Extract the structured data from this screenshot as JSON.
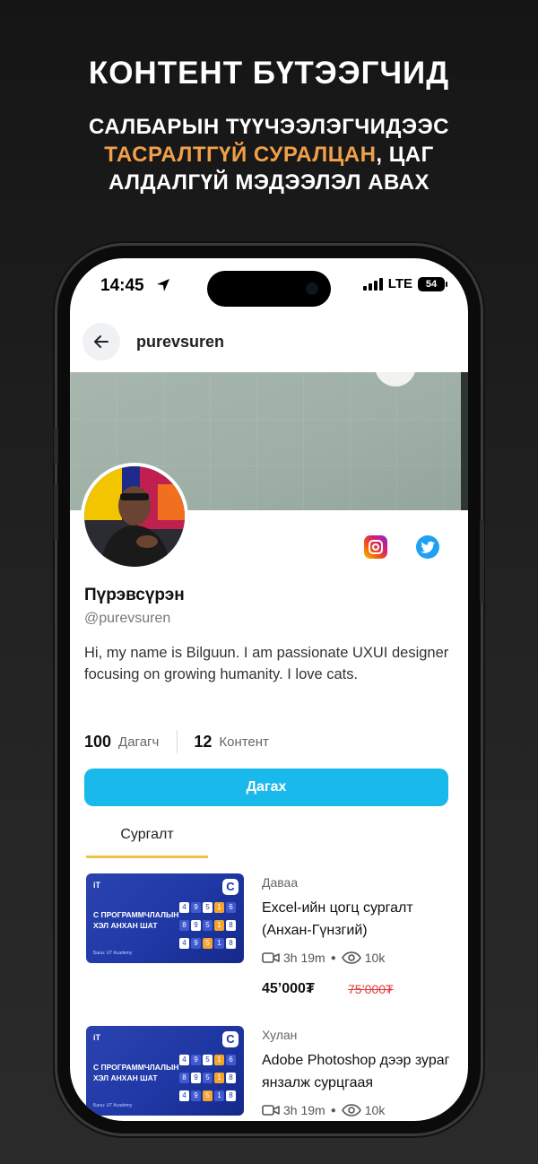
{
  "promo": {
    "title": "КОНТЕНТ БҮТЭЭГЧИД",
    "subtitle_line1": "САЛБАРЫН ТҮҮЧЭЭЛЭГЧИДЭЭС",
    "subtitle_accent": "ТАСРАЛТГҮЙ СУРАЛЦАН",
    "subtitle_after_accent": ", ЦАГ",
    "subtitle_line3": "АЛДАЛГҮЙ МЭДЭЭЛЭЛ АВАХ",
    "accent_color": "#f0a04a"
  },
  "status_bar": {
    "time": "14:45",
    "network": "LTE",
    "battery": "54"
  },
  "header": {
    "username": "purevsuren",
    "back_icon": "arrow-left-icon"
  },
  "profile": {
    "display_name": "Пүрэвсүрэн",
    "handle": "@purevsuren",
    "bio": "Hi, my name is Bilguun. I am passionate UXUI designer focusing on growing humanity. I love cats.",
    "social_icons": [
      "instagram-icon",
      "twitter-icon"
    ],
    "stats": {
      "followers_count": "100",
      "followers_label": "Дагагч",
      "content_count": "12",
      "content_label": "Контент"
    },
    "follow_label": "Дагах",
    "follow_color": "#1ab9ec"
  },
  "tabs": {
    "active": "Сургалт"
  },
  "courses": [
    {
      "author": "Даваа",
      "title": "Excel-ийн цогц сургалт (Анхан-Гүнзгий)",
      "duration": "3h 19m",
      "views": "10k",
      "price": "45’000₮",
      "old_price": "75’000₮",
      "thumb": {
        "logo": "iT",
        "badge": "C",
        "text_line1": "С ПРОГРАММЧЛАЛЫН",
        "text_line2": "ХЭЛ АНХАН ШАТ",
        "footer": "Багш: UT Academy"
      }
    },
    {
      "author": "Хулан",
      "title": "Adobe Photoshop дээр зураг янзалж сурцгаая",
      "duration": "3h 19m",
      "views": "10k",
      "thumb": {
        "logo": "iT",
        "badge": "C",
        "text_line1": "С ПРОГРАММЧЛАЛЫН",
        "text_line2": "ХЭЛ АНХАН ШАТ",
        "footer": "Багш: UT Academy"
      }
    }
  ]
}
